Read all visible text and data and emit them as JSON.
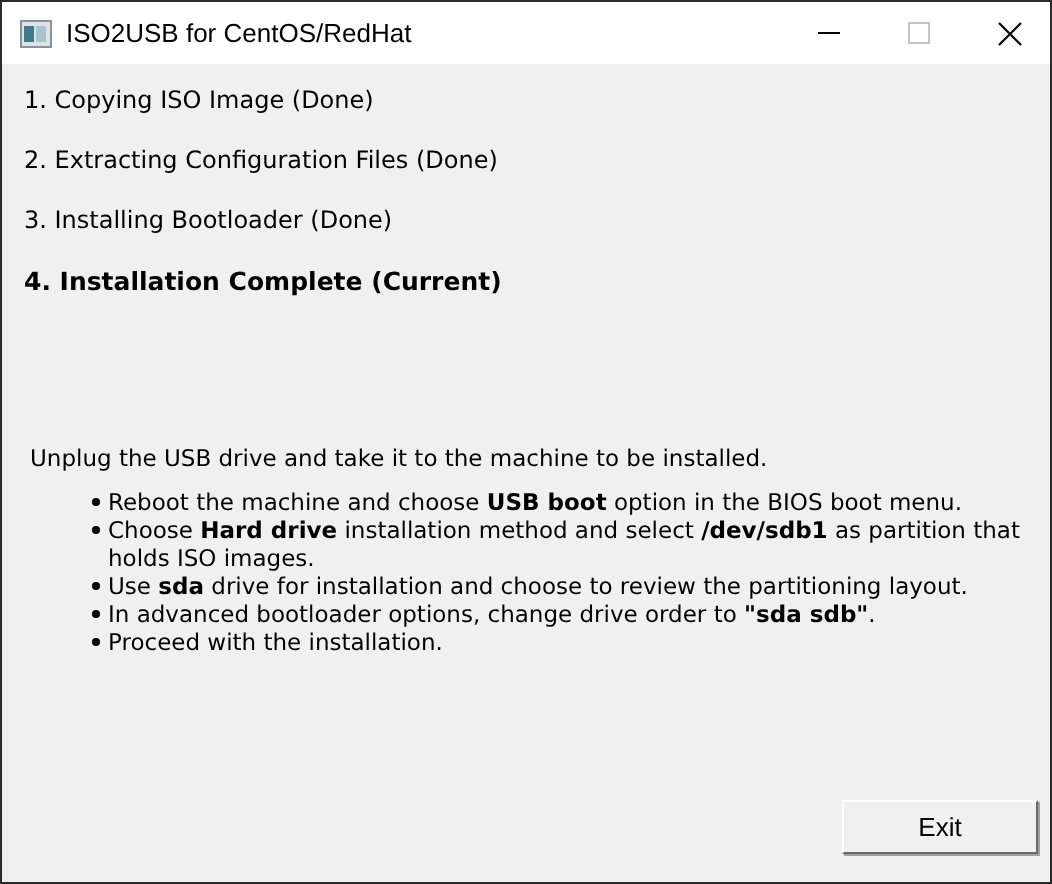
{
  "window": {
    "title": "ISO2USB for CentOS/RedHat"
  },
  "steps": [
    {
      "label": "1. Copying ISO Image (Done)",
      "current": false
    },
    {
      "label": "2. Extracting Configuration Files (Done)",
      "current": false
    },
    {
      "label": "3. Installing Bootloader (Done)",
      "current": false
    },
    {
      "label": "4. Installation Complete (Current)",
      "current": true
    }
  ],
  "instruction": "Unplug the USB drive and take it to the machine to be installed.",
  "bullets": [
    "Reboot the machine and choose **USB boot** option in the BIOS boot menu.",
    "Choose **Hard drive** installation method and select **/dev/sdb1** as partition that holds ISO images.",
    "Use **sda** drive for installation and choose to review the partitioning layout.",
    "In advanced bootloader options, change drive order to **\"sda sdb\"**.",
    "Proceed with the installation."
  ],
  "buttons": [
    "Exit"
  ]
}
